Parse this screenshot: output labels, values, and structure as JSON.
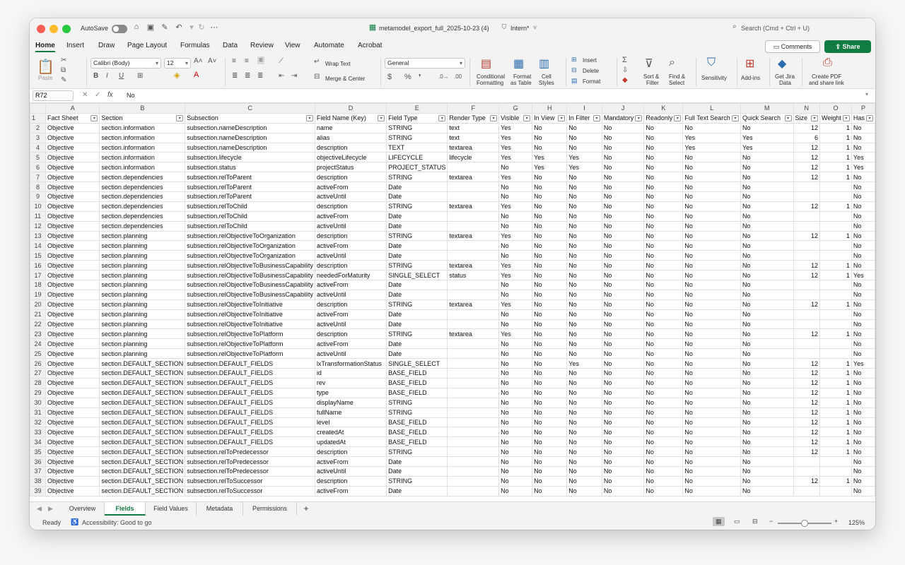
{
  "window": {
    "autosave_label": "AutoSave",
    "doc_title": "metamodel_export_full_2025-10-23 (4)",
    "sensitivity_label": "Intern*",
    "search_placeholder": "Search (Cmd + Ctrl + U)"
  },
  "menu": {
    "tabs": [
      "Home",
      "Insert",
      "Draw",
      "Page Layout",
      "Formulas",
      "Data",
      "Review",
      "View",
      "Automate",
      "Acrobat"
    ],
    "active_tab": "Home",
    "comments_label": "Comments",
    "share_label": "Share"
  },
  "ribbon": {
    "paste": "Paste",
    "font_name": "Calibri (Body)",
    "font_size": "12",
    "wrap_text": "Wrap Text",
    "merge_center": "Merge & Center",
    "number_format": "General",
    "conditional_formatting": [
      "Conditional",
      "Formatting"
    ],
    "format_as_table": [
      "Format",
      "as Table"
    ],
    "cell_styles": [
      "Cell",
      "Styles"
    ],
    "insert": "Insert",
    "delete": "Delete",
    "format": "Format",
    "sort_filter": [
      "Sort &",
      "Filter"
    ],
    "find_select": [
      "Find &",
      "Select"
    ],
    "sensitivity": "Sensitivity",
    "addins": "Add-ins",
    "jira": [
      "Get Jira",
      "Data"
    ],
    "pdf": [
      "Create PDF",
      "and share link"
    ]
  },
  "formula_bar": {
    "cell_ref": "R72",
    "fx": "fx",
    "value": "No"
  },
  "grid": {
    "columns": [
      "A",
      "B",
      "C",
      "D",
      "E",
      "F",
      "G",
      "H",
      "I",
      "J",
      "K",
      "L",
      "M",
      "N",
      "O",
      "P"
    ],
    "headers": [
      "Fact Sheet",
      "Section",
      "Subsection",
      "Field Name (Key)",
      "Field Type",
      "Render Type",
      "Visible",
      "In View",
      "In Filter",
      "Mandatory",
      "Readonly",
      "Full Text Search",
      "Quick Search",
      "Size",
      "Weight",
      "Has"
    ],
    "rows": [
      [
        "Objective",
        "section.information",
        "subsection.nameDescription",
        "name",
        "STRING",
        "text",
        "Yes",
        "No",
        "No",
        "No",
        "No",
        "No",
        "No",
        "12",
        "1",
        "No"
      ],
      [
        "Objective",
        "section.information",
        "subsection.nameDescription",
        "alias",
        "STRING",
        "text",
        "Yes",
        "No",
        "No",
        "No",
        "No",
        "Yes",
        "Yes",
        "6",
        "1",
        "No"
      ],
      [
        "Objective",
        "section.information",
        "subsection.nameDescription",
        "description",
        "TEXT",
        "textarea",
        "Yes",
        "No",
        "No",
        "No",
        "No",
        "Yes",
        "Yes",
        "12",
        "1",
        "No"
      ],
      [
        "Objective",
        "section.information",
        "subsection.lifecycle",
        "objectiveLifecycle",
        "LIFECYCLE",
        "lifecycle",
        "Yes",
        "Yes",
        "Yes",
        "No",
        "No",
        "No",
        "No",
        "12",
        "1",
        "Yes"
      ],
      [
        "Objective",
        "section.information",
        "subsection.status",
        "projectStatus",
        "PROJECT_STATUS",
        "",
        "No",
        "Yes",
        "Yes",
        "No",
        "No",
        "No",
        "No",
        "12",
        "1",
        "Yes"
      ],
      [
        "Objective",
        "section.dependencies",
        "subsection.relToParent",
        "description",
        "STRING",
        "textarea",
        "Yes",
        "No",
        "No",
        "No",
        "No",
        "No",
        "No",
        "12",
        "1",
        "No"
      ],
      [
        "Objective",
        "section.dependencies",
        "subsection.relToParent",
        "activeFrom",
        "Date",
        "",
        "No",
        "No",
        "No",
        "No",
        "No",
        "No",
        "No",
        "",
        "",
        "No"
      ],
      [
        "Objective",
        "section.dependencies",
        "subsection.relToParent",
        "activeUntil",
        "Date",
        "",
        "No",
        "No",
        "No",
        "No",
        "No",
        "No",
        "No",
        "",
        "",
        "No"
      ],
      [
        "Objective",
        "section.dependencies",
        "subsection.relToChild",
        "description",
        "STRING",
        "textarea",
        "Yes",
        "No",
        "No",
        "No",
        "No",
        "No",
        "No",
        "12",
        "1",
        "No"
      ],
      [
        "Objective",
        "section.dependencies",
        "subsection.relToChild",
        "activeFrom",
        "Date",
        "",
        "No",
        "No",
        "No",
        "No",
        "No",
        "No",
        "No",
        "",
        "",
        "No"
      ],
      [
        "Objective",
        "section.dependencies",
        "subsection.relToChild",
        "activeUntil",
        "Date",
        "",
        "No",
        "No",
        "No",
        "No",
        "No",
        "No",
        "No",
        "",
        "",
        "No"
      ],
      [
        "Objective",
        "section.planning",
        "subsection.relObjectiveToOrganization",
        "description",
        "STRING",
        "textarea",
        "Yes",
        "No",
        "No",
        "No",
        "No",
        "No",
        "No",
        "12",
        "1",
        "No"
      ],
      [
        "Objective",
        "section.planning",
        "subsection.relObjectiveToOrganization",
        "activeFrom",
        "Date",
        "",
        "No",
        "No",
        "No",
        "No",
        "No",
        "No",
        "No",
        "",
        "",
        "No"
      ],
      [
        "Objective",
        "section.planning",
        "subsection.relObjectiveToOrganization",
        "activeUntil",
        "Date",
        "",
        "No",
        "No",
        "No",
        "No",
        "No",
        "No",
        "No",
        "",
        "",
        "No"
      ],
      [
        "Objective",
        "section.planning",
        "subsection.relObjectiveToBusinessCapability",
        "description",
        "STRING",
        "textarea",
        "Yes",
        "No",
        "No",
        "No",
        "No",
        "No",
        "No",
        "12",
        "1",
        "No"
      ],
      [
        "Objective",
        "section.planning",
        "subsection.relObjectiveToBusinessCapability",
        "neededForMaturity",
        "SINGLE_SELECT",
        "status",
        "Yes",
        "No",
        "No",
        "No",
        "No",
        "No",
        "No",
        "12",
        "1",
        "Yes"
      ],
      [
        "Objective",
        "section.planning",
        "subsection.relObjectiveToBusinessCapability",
        "activeFrom",
        "Date",
        "",
        "No",
        "No",
        "No",
        "No",
        "No",
        "No",
        "No",
        "",
        "",
        "No"
      ],
      [
        "Objective",
        "section.planning",
        "subsection.relObjectiveToBusinessCapability",
        "activeUntil",
        "Date",
        "",
        "No",
        "No",
        "No",
        "No",
        "No",
        "No",
        "No",
        "",
        "",
        "No"
      ],
      [
        "Objective",
        "section.planning",
        "subsection.relObjectiveToInitiative",
        "description",
        "STRING",
        "textarea",
        "Yes",
        "No",
        "No",
        "No",
        "No",
        "No",
        "No",
        "12",
        "1",
        "No"
      ],
      [
        "Objective",
        "section.planning",
        "subsection.relObjectiveToInitiative",
        "activeFrom",
        "Date",
        "",
        "No",
        "No",
        "No",
        "No",
        "No",
        "No",
        "No",
        "",
        "",
        "No"
      ],
      [
        "Objective",
        "section.planning",
        "subsection.relObjectiveToInitiative",
        "activeUntil",
        "Date",
        "",
        "No",
        "No",
        "No",
        "No",
        "No",
        "No",
        "No",
        "",
        "",
        "No"
      ],
      [
        "Objective",
        "section.planning",
        "subsection.relObjectiveToPlatform",
        "description",
        "STRING",
        "textarea",
        "Yes",
        "No",
        "No",
        "No",
        "No",
        "No",
        "No",
        "12",
        "1",
        "No"
      ],
      [
        "Objective",
        "section.planning",
        "subsection.relObjectiveToPlatform",
        "activeFrom",
        "Date",
        "",
        "No",
        "No",
        "No",
        "No",
        "No",
        "No",
        "No",
        "",
        "",
        "No"
      ],
      [
        "Objective",
        "section.planning",
        "subsection.relObjectiveToPlatform",
        "activeUntil",
        "Date",
        "",
        "No",
        "No",
        "No",
        "No",
        "No",
        "No",
        "No",
        "",
        "",
        "No"
      ],
      [
        "Objective",
        "section.DEFAULT_SECTION",
        "subsection.DEFAULT_FIELDS",
        "lxTransformationStatus",
        "SINGLE_SELECT",
        "",
        "No",
        "No",
        "Yes",
        "No",
        "No",
        "No",
        "No",
        "12",
        "1",
        "Yes"
      ],
      [
        "Objective",
        "section.DEFAULT_SECTION",
        "subsection.DEFAULT_FIELDS",
        "id",
        "BASE_FIELD",
        "",
        "No",
        "No",
        "No",
        "No",
        "No",
        "No",
        "No",
        "12",
        "1",
        "No"
      ],
      [
        "Objective",
        "section.DEFAULT_SECTION",
        "subsection.DEFAULT_FIELDS",
        "rev",
        "BASE_FIELD",
        "",
        "No",
        "No",
        "No",
        "No",
        "No",
        "No",
        "No",
        "12",
        "1",
        "No"
      ],
      [
        "Objective",
        "section.DEFAULT_SECTION",
        "subsection.DEFAULT_FIELDS",
        "type",
        "BASE_FIELD",
        "",
        "No",
        "No",
        "No",
        "No",
        "No",
        "No",
        "No",
        "12",
        "1",
        "No"
      ],
      [
        "Objective",
        "section.DEFAULT_SECTION",
        "subsection.DEFAULT_FIELDS",
        "displayName",
        "STRING",
        "",
        "No",
        "No",
        "No",
        "No",
        "No",
        "No",
        "No",
        "12",
        "1",
        "No"
      ],
      [
        "Objective",
        "section.DEFAULT_SECTION",
        "subsection.DEFAULT_FIELDS",
        "fullName",
        "STRING",
        "",
        "No",
        "No",
        "No",
        "No",
        "No",
        "No",
        "No",
        "12",
        "1",
        "No"
      ],
      [
        "Objective",
        "section.DEFAULT_SECTION",
        "subsection.DEFAULT_FIELDS",
        "level",
        "BASE_FIELD",
        "",
        "No",
        "No",
        "No",
        "No",
        "No",
        "No",
        "No",
        "12",
        "1",
        "No"
      ],
      [
        "Objective",
        "section.DEFAULT_SECTION",
        "subsection.DEFAULT_FIELDS",
        "createdAt",
        "BASE_FIELD",
        "",
        "No",
        "No",
        "No",
        "No",
        "No",
        "No",
        "No",
        "12",
        "1",
        "No"
      ],
      [
        "Objective",
        "section.DEFAULT_SECTION",
        "subsection.DEFAULT_FIELDS",
        "updatedAt",
        "BASE_FIELD",
        "",
        "No",
        "No",
        "No",
        "No",
        "No",
        "No",
        "No",
        "12",
        "1",
        "No"
      ],
      [
        "Objective",
        "section.DEFAULT_SECTION",
        "subsection.relToPredecessor",
        "description",
        "STRING",
        "",
        "No",
        "No",
        "No",
        "No",
        "No",
        "No",
        "No",
        "12",
        "1",
        "No"
      ],
      [
        "Objective",
        "section.DEFAULT_SECTION",
        "subsection.relToPredecessor",
        "activeFrom",
        "Date",
        "",
        "No",
        "No",
        "No",
        "No",
        "No",
        "No",
        "No",
        "",
        "",
        "No"
      ],
      [
        "Objective",
        "section.DEFAULT_SECTION",
        "subsection.relToPredecessor",
        "activeUntil",
        "Date",
        "",
        "No",
        "No",
        "No",
        "No",
        "No",
        "No",
        "No",
        "",
        "",
        "No"
      ],
      [
        "Objective",
        "section.DEFAULT_SECTION",
        "subsection.relToSuccessor",
        "description",
        "STRING",
        "",
        "No",
        "No",
        "No",
        "No",
        "No",
        "No",
        "No",
        "12",
        "1",
        "No"
      ],
      [
        "Objective",
        "section.DEFAULT_SECTION",
        "subsection.relToSuccessor",
        "activeFrom",
        "Date",
        "",
        "No",
        "No",
        "No",
        "No",
        "No",
        "No",
        "No",
        "",
        "",
        "No"
      ]
    ]
  },
  "sheets": {
    "tabs": [
      "Overview",
      "Fields",
      "Field Values",
      "Metadata",
      "Permissions"
    ],
    "active": "Fields",
    "add": "+"
  },
  "status": {
    "ready": "Ready",
    "accessibility": "Accessibility: Good to go",
    "zoom": "125%",
    "zoom_level": 0.5
  }
}
